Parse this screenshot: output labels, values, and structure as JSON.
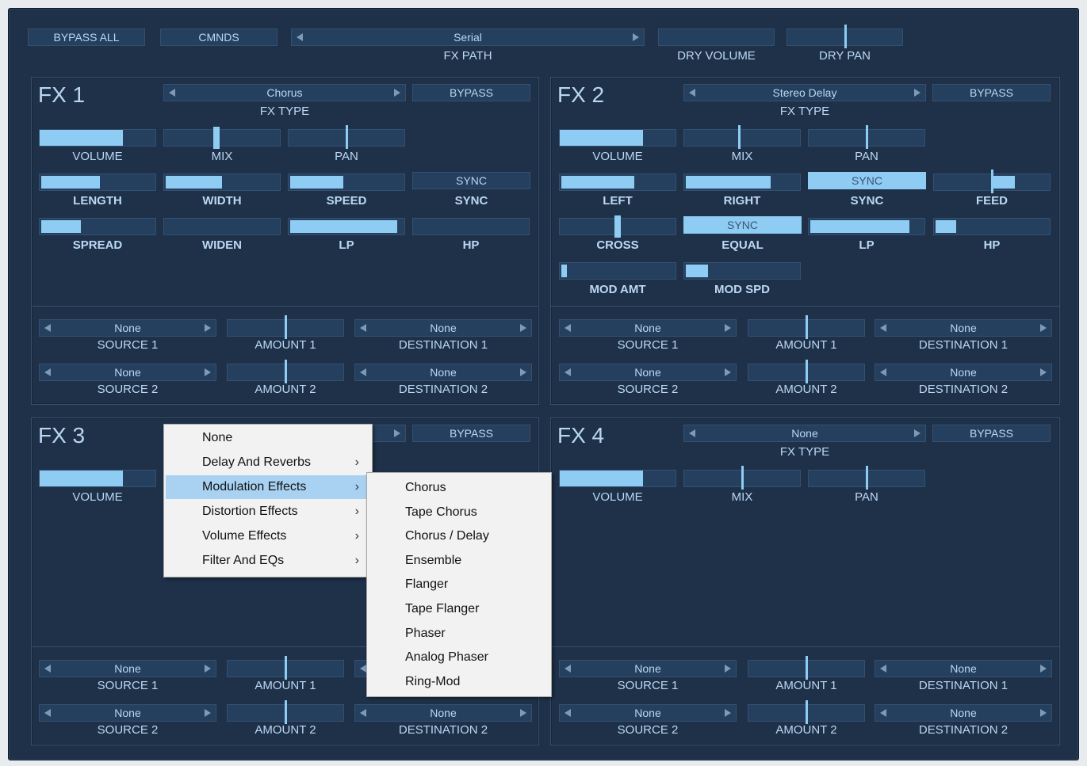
{
  "top": {
    "bypass_all": "BYPASS ALL",
    "cmnds": "CMNDS",
    "fx_path_value": "Serial",
    "fx_path_label": "FX PATH",
    "dry_volume_label": "DRY VOLUME",
    "dry_pan_label": "DRY PAN",
    "dry_volume_level": 0,
    "dry_pan_level": 0.5
  },
  "fx1": {
    "title": "FX 1",
    "fx_type_value": "Chorus",
    "fx_type_label": "FX TYPE",
    "bypass": "BYPASS",
    "volume": "VOLUME",
    "volume_level": 0.72,
    "mix": "MIX",
    "mix_level": 0.45,
    "pan": "PAN",
    "pan_level": 0.5,
    "length": "LENGTH",
    "length_level": 0.52,
    "width": "WIDTH",
    "width_level": 0.5,
    "speed": "SPEED",
    "speed_level": 0.47,
    "sync_button": "SYNC",
    "sync_label": "SYNC",
    "spread": "SPREAD",
    "spread_level": 0.35,
    "widen": "WIDEN",
    "widen_level": 0,
    "lp": "LP",
    "lp_level": 0.95,
    "hp": "HP",
    "hp_level": 0
  },
  "fx2": {
    "title": "FX 2",
    "fx_type_value": "Stereo Delay",
    "fx_type_label": "FX TYPE",
    "bypass": "BYPASS",
    "volume": "VOLUME",
    "volume_level": 0.72,
    "mix": "MIX",
    "mix_level": 0.47,
    "pan": "PAN",
    "pan_level": 0.5,
    "left": "LEFT",
    "left_level": 0.65,
    "right": "RIGHT",
    "right_level": 0.75,
    "sync_button": "SYNC",
    "sync_label": "SYNC",
    "feed": "FEED",
    "feed_level": 0.5,
    "cross": "CROSS",
    "cross_level": 0.5,
    "equal_button": "SYNC",
    "equal_label": "EQUAL",
    "lp": "LP",
    "lp_level": 0.88,
    "hp": "HP",
    "hp_level": 0.18,
    "mod_amt": "MOD AMT",
    "mod_amt_level": 0.05,
    "mod_spd": "MOD SPD",
    "mod_spd_level": 0.2
  },
  "fx3": {
    "title": "FX 3",
    "bypass": "BYPASS",
    "volume": "VOLUME",
    "volume_level": 0.72
  },
  "fx4": {
    "title": "FX 4",
    "fx_type_value": "None",
    "fx_type_label": "FX TYPE",
    "bypass": "BYPASS",
    "volume": "VOLUME",
    "volume_level": 0.72,
    "mix": "MIX",
    "mix_level": 0.5,
    "pan": "PAN",
    "pan_level": 0.5
  },
  "mod": {
    "none": "None",
    "source1": "SOURCE 1",
    "source2": "SOURCE 2",
    "amount1": "AMOUNT 1",
    "amount2": "AMOUNT 2",
    "dest1": "DESTINATION 1",
    "dest2": "DESTINATION 2",
    "amount_level": 0.5
  },
  "menu": {
    "items": [
      "None",
      "Delay And Reverbs",
      "Modulation Effects",
      "Distortion Effects",
      "Volume Effects",
      "Filter And EQs"
    ],
    "highlighted": "Modulation Effects",
    "chevron": "›",
    "submenu": [
      "Chorus",
      "Tape Chorus",
      "Chorus / Delay",
      "Ensemble",
      "Flanger",
      "Tape Flanger",
      "Phaser",
      "Analog Phaser",
      "Ring-Mod"
    ]
  },
  "colors": {
    "background": "#1e3149",
    "accent": "#8fccf4",
    "text": "#b9d6f2",
    "menu_highlight": "#a9d2f2"
  }
}
